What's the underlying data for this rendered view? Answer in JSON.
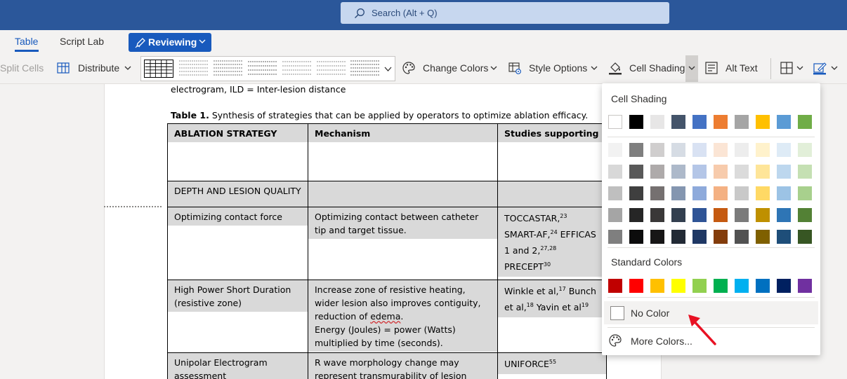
{
  "search": {
    "placeholder": "Search (Alt + Q)"
  },
  "tabs": [
    {
      "label": "Table",
      "active": true
    },
    {
      "label": "Script Lab",
      "active": false
    }
  ],
  "reviewing": {
    "label": "Reviewing"
  },
  "ribbon": {
    "split_cells": "Split Cells",
    "distribute": "Distribute",
    "change_colors": "Change Colors",
    "style_options": "Style Options",
    "cell_shading": "Cell Shading",
    "alt_text": "Alt Text"
  },
  "document": {
    "line_above": "electrogram, ILD = Inter-lesion distance",
    "caption_bold": "Table 1.",
    "caption_rest": " Synthesis of strategies that can be applied by operators to optimize ablation efficacy.",
    "table": {
      "headers": [
        "ABLATION STRATEGY",
        "Mechanism",
        "Studies supporting"
      ],
      "section": "DEPTH AND LESION QUALITY",
      "rows": [
        {
          "strategy": "Optimizing contact force",
          "mechanism": "Optimizing contact between catheter tip and target tissue.",
          "studies": [
            "TOCCASTAR,",
            "23",
            " SMART-AF,",
            "24",
            " EFFICAS 1 and 2,",
            "27,28",
            " PRECEPT",
            "30"
          ]
        },
        {
          "strategy": "High Power Short Duration (resistive zone)",
          "mechanism_lines": [
            "Increase zone of resistive heating, wider lesion also improves contiguity, reduction of ",
            "edema",
            "."
          ],
          "mechanism_extra": "Energy (Joules) = power (Watts) multiplied by time (seconds).",
          "studies": [
            "Winkle et al,",
            "17",
            " Bunch et al,",
            "18",
            " Yavin et al",
            "19"
          ]
        },
        {
          "strategy": "Unipolar Electrogram assessment",
          "mechanism": "R wave morphology change may represent transmurability of lesion",
          "studies": [
            "UNIFORCE",
            "55"
          ]
        }
      ]
    }
  },
  "cell_shading_panel": {
    "title": "Cell Shading",
    "theme_top": [
      "#ffffff",
      "#000000",
      "#e7e6e6",
      "#44546a",
      "#4472c4",
      "#ed7d31",
      "#a5a5a5",
      "#ffc000",
      "#5b9bd5",
      "#70ad47"
    ],
    "theme_shades": [
      [
        "#f2f2f2",
        "#7f7f7f",
        "#d0cece",
        "#d6dce4",
        "#d9e2f3",
        "#fbe5d5",
        "#ededed",
        "#fff2cc",
        "#deebf6",
        "#e2efd9"
      ],
      [
        "#d8d8d8",
        "#595959",
        "#aeaaaa",
        "#adb9ca",
        "#b4c6e7",
        "#f7cbac",
        "#dbdbdb",
        "#fee599",
        "#bdd7ee",
        "#c5e0b3"
      ],
      [
        "#bfbfbf",
        "#3f3f3f",
        "#757070",
        "#8496b0",
        "#8eaadb",
        "#f4b183",
        "#c9c9c9",
        "#ffd965",
        "#9cc3e5",
        "#a8d08d"
      ],
      [
        "#a5a5a5",
        "#262626",
        "#3a3838",
        "#323f4f",
        "#2f5496",
        "#c55a11",
        "#7b7b7b",
        "#bf9000",
        "#2e75b5",
        "#538135"
      ],
      [
        "#7f7f7f",
        "#0c0c0c",
        "#171616",
        "#222a35",
        "#1f3864",
        "#833c0b",
        "#525252",
        "#7f6000",
        "#1e4e79",
        "#375623"
      ]
    ],
    "standard_title": "Standard Colors",
    "standard": [
      "#c00000",
      "#ff0000",
      "#ffc000",
      "#ffff00",
      "#92d050",
      "#00b050",
      "#00b0f0",
      "#0070c0",
      "#002060",
      "#7030a0"
    ],
    "no_color": "No Color",
    "more_colors": "More Colors..."
  },
  "colors": {
    "accent": "#185abd",
    "titlebar": "#2b579a",
    "arrow": "#e81123"
  }
}
